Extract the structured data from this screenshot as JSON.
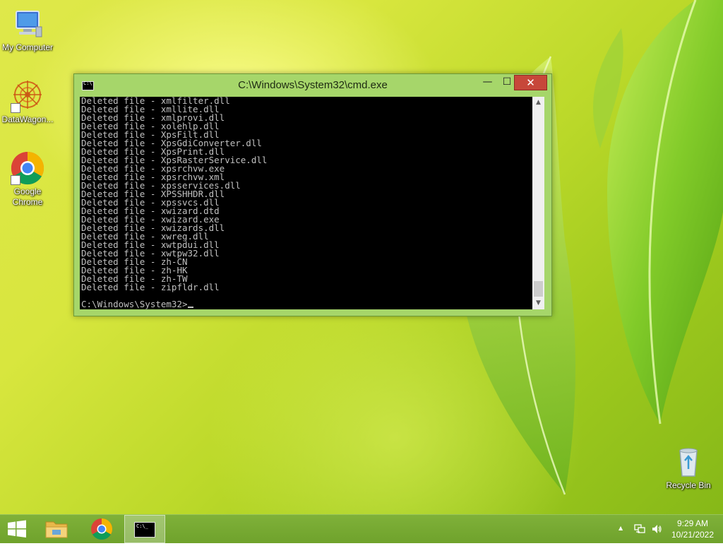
{
  "desktop": {
    "icons": [
      {
        "label": "My Computer",
        "icon": "computer-icon"
      },
      {
        "label": "DataWagon...",
        "icon": "datawagon-icon"
      },
      {
        "label": "Google Chrome",
        "icon": "chrome-icon"
      },
      {
        "label": "Recycle Bin",
        "icon": "recycle-bin-icon"
      }
    ]
  },
  "cmd": {
    "title": "C:\\Windows\\System32\\cmd.exe",
    "lines": [
      "Deleted file - xmlfilter.dll",
      "Deleted file - xmllite.dll",
      "Deleted file - xmlprovi.dll",
      "Deleted file - xolehlp.dll",
      "Deleted file - XpsFilt.dll",
      "Deleted file - XpsGdiConverter.dll",
      "Deleted file - XpsPrint.dll",
      "Deleted file - XpsRasterService.dll",
      "Deleted file - xpsrchvw.exe",
      "Deleted file - xpsrchvw.xml",
      "Deleted file - xpsservices.dll",
      "Deleted file - XPSSHHDR.dll",
      "Deleted file - xpssvcs.dll",
      "Deleted file - xwizard.dtd",
      "Deleted file - xwizard.exe",
      "Deleted file - xwizards.dll",
      "Deleted file - xwreg.dll",
      "Deleted file - xwtpdui.dll",
      "Deleted file - xwtpw32.dll",
      "Deleted file - zh-CN",
      "Deleted file - zh-HK",
      "Deleted file - zh-TW",
      "Deleted file - zipfldr.dll"
    ],
    "prompt": "C:\\Windows\\System32>",
    "title_icon_text": "C:\\",
    "minimize_glyph": "—",
    "maximize_glyph": "☐",
    "close_glyph": "✕",
    "scroll_up_glyph": "▲",
    "scroll_down_glyph": "▼"
  },
  "taskbar": {
    "items": [
      "start-button",
      "file-explorer",
      "google-chrome",
      "command-prompt"
    ],
    "cmd_icon_text": "C:\\_",
    "tray": {
      "show_hidden_glyph": "▲",
      "network_icon": "network-icon",
      "volume_icon": "volume-icon"
    },
    "time": "9:29 AM",
    "date": "10/21/2022"
  },
  "colors": {
    "taskbar": "#76aa33",
    "window_frame": "#a6d66a",
    "close_button": "#c7473a",
    "console_bg": "#000000",
    "console_text": "#c0c0c0"
  }
}
